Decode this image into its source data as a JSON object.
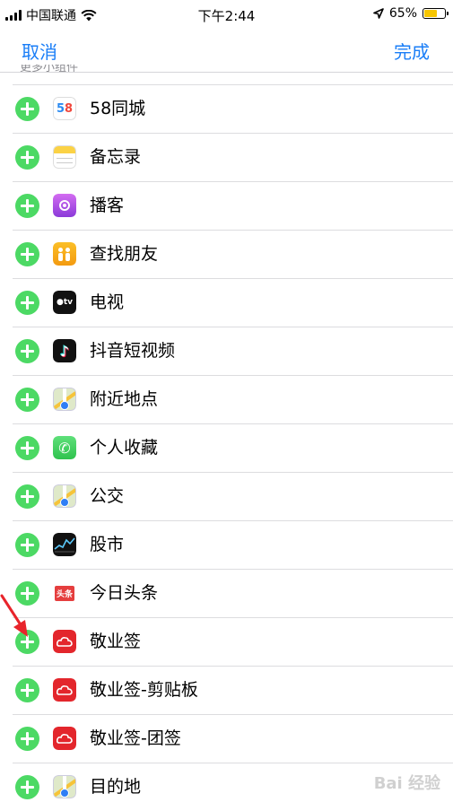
{
  "status": {
    "carrier": "中国联通",
    "time": "下午2:44",
    "battery": "65%"
  },
  "nav": {
    "cancel": "取消",
    "done": "完成"
  },
  "section": {
    "peek": "更多小组件"
  },
  "items": [
    {
      "label": "58同城",
      "icon": "tongcheng58-icon",
      "name": "58tongcheng"
    },
    {
      "label": "备忘录",
      "icon": "notes-icon",
      "name": "notes"
    },
    {
      "label": "播客",
      "icon": "podcasts-icon",
      "name": "podcasts"
    },
    {
      "label": "查找朋友",
      "icon": "find-friends-icon",
      "name": "find-friends"
    },
    {
      "label": "电视",
      "icon": "tv-icon",
      "name": "tv"
    },
    {
      "label": "抖音短视频",
      "icon": "douyin-icon",
      "name": "douyin"
    },
    {
      "label": "附近地点",
      "icon": "maps-icon",
      "name": "nearby"
    },
    {
      "label": "个人收藏",
      "icon": "phone-icon",
      "name": "favorites"
    },
    {
      "label": "公交",
      "icon": "maps-icon",
      "name": "transit"
    },
    {
      "label": "股市",
      "icon": "stocks-icon",
      "name": "stocks"
    },
    {
      "label": "今日头条",
      "icon": "toutiao-icon",
      "name": "toutiao"
    },
    {
      "label": "敬业签",
      "icon": "jingyeqian-icon",
      "name": "jingyeqian"
    },
    {
      "label": "敬业签-剪贴板",
      "icon": "jingyeqian-icon",
      "name": "jingyeqian-clipboard"
    },
    {
      "label": "敬业签-团签",
      "icon": "jingyeqian-icon",
      "name": "jingyeqian-team"
    },
    {
      "label": "目的地",
      "icon": "maps-icon",
      "name": "destination"
    }
  ],
  "watermark": "Bai 经验",
  "colors": {
    "accent": "#1a7ef7",
    "add": "#4cd964",
    "arrow": "#e8242b"
  }
}
